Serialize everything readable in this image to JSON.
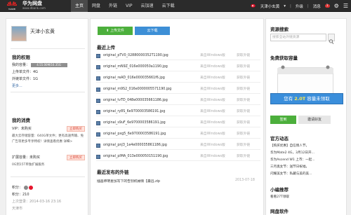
{
  "brand": {
    "name": "华为网盘",
    "sub": "www.dbank.com",
    "logo_text": "HUAWEI"
  },
  "nav": [
    {
      "label": "主页",
      "active": true
    },
    {
      "label": "网盘",
      "active": false
    },
    {
      "label": "外链",
      "active": false
    },
    {
      "label": "VIP",
      "active": false
    },
    {
      "label": "云加速",
      "active": false
    },
    {
      "label": "云下载",
      "active": false
    }
  ],
  "topbar": {
    "user": "天津小玄黄",
    "upgrade": "升级",
    "messages": "消息",
    "msg_count": "1"
  },
  "profile": {
    "name": "天津小玄黄"
  },
  "rights": {
    "title": "我的权限",
    "capacity_label": "我的容量：",
    "capacity_bar": "4.55.00M/16.35G",
    "upload_label": "上传单文件：4G",
    "download_label": "外链单文件：1G",
    "more": "更多..."
  },
  "consume": {
    "title": "我的消费",
    "vip_label": "VIP：未购买",
    "buy_label": "立即购买",
    "desc": "最大云存储容量：640G单文件；更有高速传输、免广告等更多专享特权！详情查看优惠 详细>",
    "ext_label": "扩展容量：未购买",
    "ext_buy": "立即购买",
    "ext_desc": "0G到15T单独扩展服务"
  },
  "stats": {
    "points_label": "积分：",
    "level_label": "积分：210",
    "last_login": "上次登录：2014-03-16 23:16",
    "location": "天津市"
  },
  "center": {
    "upload_button": "上传文件",
    "download_button": "云下载",
    "recent_title": "最近上传",
    "files": [
      {
        "name": "original_pTV0_02880000352T1190.jpg",
        "source": "来自Windows版",
        "action": "获取外链"
      },
      {
        "name": "original_mN9Z_016e000050a1190.jpg",
        "source": "来自Windows版",
        "action": "获取外链"
      },
      {
        "name": "original_reAD_016e000035661f6.jpg",
        "source": "来自Windows版",
        "action": "获取外链"
      },
      {
        "name": "original_m9S2_016e0000005571190.jpg",
        "source": "来自Windows版",
        "action": "获取外链"
      },
      {
        "name": "original_tvTD_048e000035661186.jpg",
        "source": "来自Windows版",
        "action": "获取外链"
      },
      {
        "name": "original_ry8S_6e9700003586191.jpg",
        "source": "来自Windows版",
        "action": "获取外链"
      },
      {
        "name": "original_s9uF_6e9700003586191.jpg",
        "source": "来自Windows版",
        "action": "获取外链"
      },
      {
        "name": "original_pxg5_6e9700003586191.jpg",
        "source": "来自Windows版",
        "action": "获取外链"
      },
      {
        "name": "original_pnJ3_1e4e000035861186.jpg",
        "source": "来自Windows版",
        "action": "获取外链"
      },
      {
        "name": "original_plMA_013e000050151190.jpg",
        "source": "来自Windows版",
        "action": "获取外链"
      }
    ],
    "links_title": "最近发布的外链",
    "link_item": {
      "name": "插画师明星加写下的告别机械情【最远.zip",
      "date": "2013-07-18"
    }
  },
  "right": {
    "search_title": "资源搜索",
    "search_placeholder": "搜索全站外链资源",
    "free_title": "免费获取容量",
    "redeem_prefix": "您有",
    "redeem_amount": "2.0T",
    "redeem_suffix": "容量未领取",
    "sign_button": "签到",
    "invite_button": "邀请好友",
    "news_title": "官方动态",
    "news": [
      "【购买优惠】自信情人节，",
      "华为Mate2 4G，3月12日开...",
      "华为Ascend W1 上市：一起...",
      "三月奥女节：送节日祝福，",
      "闪耀美女节：私藏与美的美..."
    ],
    "tips_title": "小编推荐",
    "tips_item": "看看27T领取",
    "software_title": "网盘软件"
  },
  "colors": {
    "topbar": "#2b2b2b",
    "green": "#4caf3c",
    "blue": "#3d8fd6",
    "red": "#d8483a"
  }
}
